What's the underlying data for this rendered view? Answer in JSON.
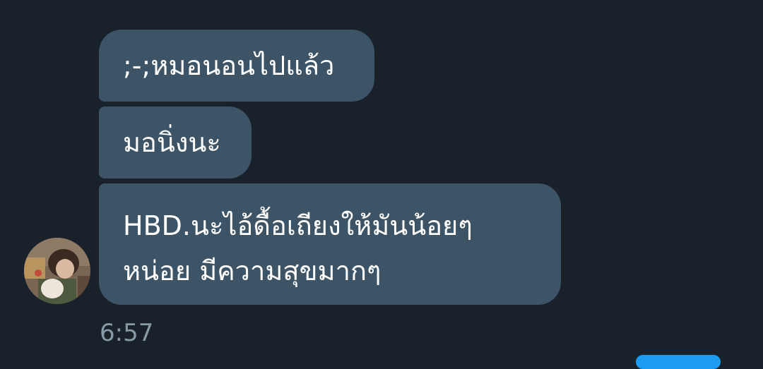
{
  "messages": [
    {
      "text": ";-;หมอนอนไปแล้ว"
    },
    {
      "text": "มอนิ่งนะ"
    },
    {
      "lines": [
        "HBD.นะไอ้ดื้อเถียงให้มันน้อยๆ",
        "หน่อย มีความสุขมากๆ"
      ]
    }
  ],
  "timestamp": "6:57",
  "colors": {
    "background": "#19212b",
    "received_bubble": "#3d5466",
    "timestamp": "#8899a6",
    "sent_bubble": "#1d9bf0"
  },
  "avatar": {
    "icon": "contact-avatar-photo"
  }
}
